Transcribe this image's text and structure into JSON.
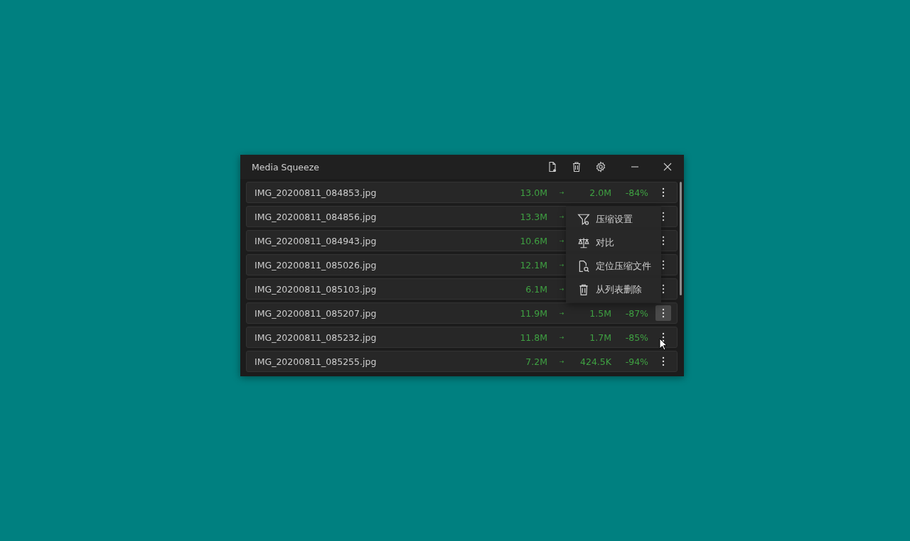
{
  "window": {
    "title": "Media Squeeze"
  },
  "toolbar": [
    {
      "kind": "add-file"
    },
    {
      "kind": "trash"
    },
    {
      "kind": "settings"
    }
  ],
  "rows": [
    {
      "name": "IMG_20200811_084853.jpg",
      "original": "13.0M",
      "arrow": "→",
      "compressed": "2.0M",
      "reduction": "-84%",
      "hovered": false
    },
    {
      "name": "IMG_20200811_084856.jpg",
      "original": "13.3M",
      "arrow": "→",
      "hovered": false
    },
    {
      "name": "IMG_20200811_084943.jpg",
      "original": "10.6M",
      "arrow": "→",
      "hovered": false
    },
    {
      "name": "IMG_20200811_085026.jpg",
      "original": "12.1M",
      "arrow": "→",
      "hovered": false
    },
    {
      "name": "IMG_20200811_085103.jpg",
      "original": "6.1M",
      "arrow": "→",
      "hovered": false
    },
    {
      "name": "IMG_20200811_085207.jpg",
      "original": "11.9M",
      "arrow": "→",
      "compressed": "1.5M",
      "reduction": "-87%",
      "hovered": true
    },
    {
      "name": "IMG_20200811_085232.jpg",
      "original": "11.8M",
      "arrow": "→",
      "compressed": "1.7M",
      "reduction": "-85%",
      "hovered": false
    },
    {
      "name": "IMG_20200811_085255.jpg",
      "original": "7.2M",
      "arrow": "→",
      "compressed": "424.5K",
      "reduction": "-94%",
      "hovered": false
    }
  ],
  "context_menu": [
    {
      "kind": "filter",
      "label": "压缩设置"
    },
    {
      "kind": "scale",
      "label": "对比"
    },
    {
      "kind": "locate",
      "label": "定位压缩文件"
    },
    {
      "kind": "delete",
      "label": "从列表删除"
    }
  ]
}
